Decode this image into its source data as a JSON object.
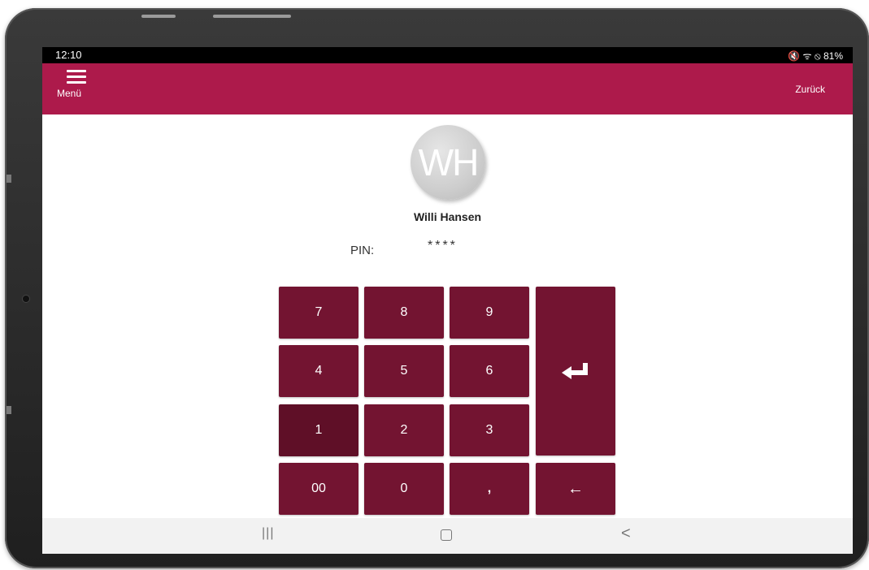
{
  "status_bar": {
    "time": "12:10",
    "icons_text": "🔇 ᯤ ⦸ 81%",
    "battery": "81%"
  },
  "app_bar": {
    "menu_label": "Menü",
    "back_label": "Zurück",
    "accent_color": "#ad1a4b"
  },
  "user": {
    "initials": "WH",
    "name": "Willi Hansen"
  },
  "pin": {
    "label": "PIN:",
    "value": "****"
  },
  "keypad": {
    "key_color": "#731431",
    "keys": {
      "k7": "7",
      "k8": "8",
      "k9": "9",
      "k4": "4",
      "k5": "5",
      "k6": "6",
      "k1": "1",
      "k2": "2",
      "k3": "3",
      "k00": "00",
      "k0": "0",
      "comma": ",",
      "backspace": "←"
    },
    "pressed_key": "1"
  },
  "nav_bar": {
    "recents": "|||",
    "back": "<"
  }
}
